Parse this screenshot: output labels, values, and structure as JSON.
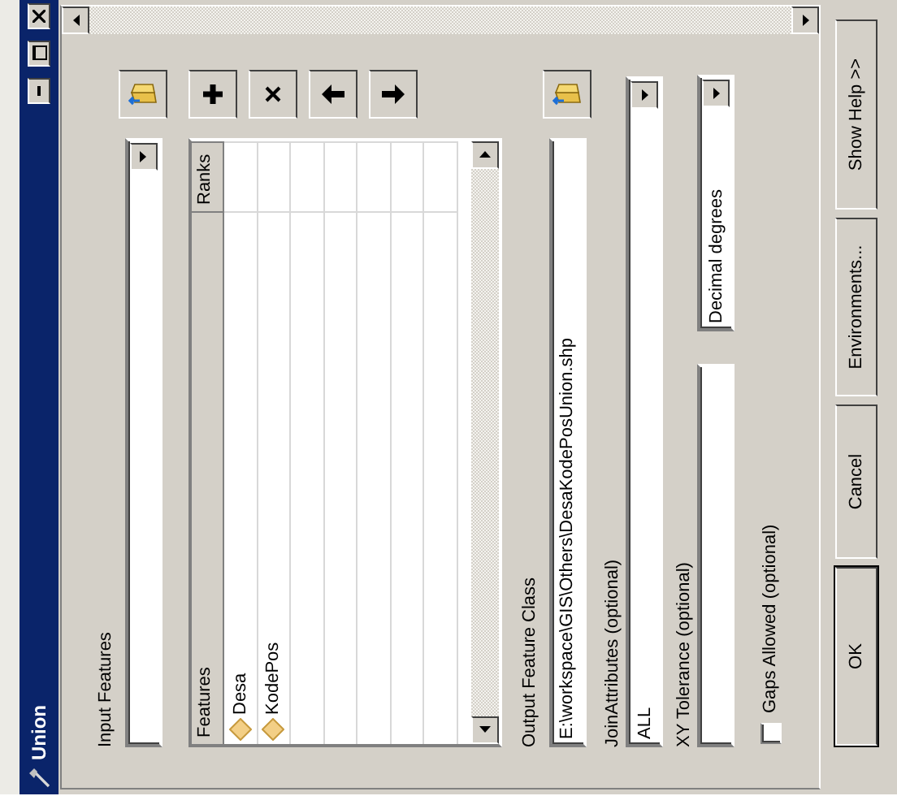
{
  "window": {
    "title": "Union"
  },
  "input_features": {
    "label": "Input Features"
  },
  "features_table": {
    "columns": [
      "Features",
      "Ranks"
    ],
    "rows": [
      {
        "feature": "Desa"
      },
      {
        "feature": "KodePos"
      }
    ]
  },
  "output_feature_class": {
    "label": "Output Feature Class",
    "value": "E:\\workspace\\GIS\\Others\\DesaKodePosUnion.shp"
  },
  "join_attributes": {
    "label": "JoinAttributes (optional)",
    "value": "ALL"
  },
  "xy_tolerance": {
    "label": "XY Tolerance (optional)",
    "units": "Decimal degrees"
  },
  "gaps_allowed": {
    "label": "Gaps Allowed (optional)",
    "checked": false
  },
  "buttons": [
    {
      "label": "OK",
      "default": true
    },
    {
      "label": "Cancel",
      "default": false
    },
    {
      "label": "Environments...",
      "default": false
    },
    {
      "label": "Show Help >>",
      "default": false
    }
  ]
}
